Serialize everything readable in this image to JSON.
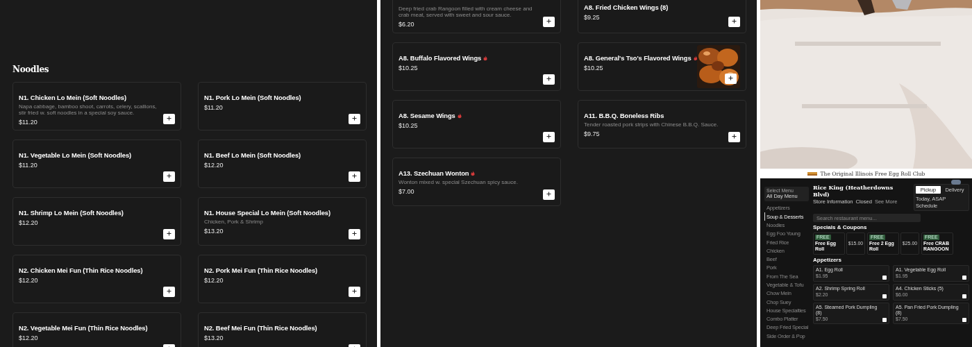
{
  "noodles_panel": {
    "heading": "Noodles",
    "items": [
      {
        "name": "N1. Chicken Lo Mein (Soft Noodles)",
        "description": "Napa cabbage, bamboo shoot, carrots, celery, scallions, stir fried w. soft noodles in a special soy sauce.",
        "price": "$11.20",
        "spicy": false,
        "has_photo": false
      },
      {
        "name": "N1. Pork Lo Mein (Soft Noodles)",
        "price": "$11.20",
        "spicy": false,
        "has_photo": false
      },
      {
        "name": "N1. Vegetable Lo Mein (Soft Noodles)",
        "price": "$11.20",
        "spicy": false,
        "has_photo": false
      },
      {
        "name": "N1. Beef Lo Mein (Soft Noodles)",
        "price": "$12.20",
        "spicy": false,
        "has_photo": false
      },
      {
        "name": "N1. Shrimp Lo Mein (Soft Noodles)",
        "price": "$12.20",
        "spicy": false,
        "has_photo": false
      },
      {
        "name": "N1. House Special Lo Mein (Soft Noodles)",
        "description": "Chicken, Pork & Shrimp",
        "price": "$13.20",
        "spicy": false,
        "has_photo": false
      },
      {
        "name": "N2. Chicken Mei Fun (Thin Rice Noodles)",
        "price": "$12.20",
        "spicy": false,
        "has_photo": false
      },
      {
        "name": "N2. Pork Mei Fun (Thin Rice Noodles)",
        "price": "$12.20",
        "spicy": false,
        "has_photo": false
      },
      {
        "name": "N2. Vegetable Mei Fun (Thin Rice Noodles)",
        "price": "$12.20",
        "spicy": false,
        "has_photo": false
      },
      {
        "name": "N2. Beef Mei Fun (Thin Rice Noodles)",
        "price": "$13.20",
        "spicy": false,
        "has_photo": false
      }
    ]
  },
  "appetizers_panel": {
    "items": [
      {
        "description": "Deep fried crab Rangoon filled with cream cheese and crab meat, served with sweet and sour sauce.",
        "price": "$6.20",
        "spicy": false,
        "has_photo": false
      },
      {
        "name": "A8. Fried Chicken Wings (8)",
        "price": "$9.25",
        "spicy": false,
        "has_photo": false
      },
      {
        "name": "A8. Buffalo Flavored Wings",
        "price": "$10.25",
        "spicy": true,
        "has_photo": false
      },
      {
        "name": "A8. General's Tso's Flavored Wings",
        "price": "$10.25",
        "spicy": true,
        "has_photo": true
      },
      {
        "name": "A8. Sesame Wings",
        "price": "$10.25",
        "spicy": true,
        "has_photo": false
      },
      {
        "name": "A11. B.B.Q. Boneless Ribs",
        "description": "Tender roasted pork strips with Chinese B.B.Q. Sauce.",
        "price": "$9.75",
        "spicy": false,
        "has_photo": false
      },
      {
        "name": "A13. Szechuan Wonton",
        "description": "Wonton mixed w. special Szechuan spicy sauce.",
        "price": "$7.00",
        "spicy": true,
        "has_photo": false
      }
    ]
  },
  "mini_site": {
    "banner": {
      "text": "The Original Illinois Free Egg Roll Club"
    },
    "menu_select": {
      "label": "Select Menu",
      "value": "All Day Menu"
    },
    "categories": [
      {
        "label": "Appetizers",
        "selected": false
      },
      {
        "label": "Soup & Desserts",
        "selected": true
      },
      {
        "label": "Noodles",
        "selected": false
      },
      {
        "label": "Egg Foo Young",
        "selected": false
      },
      {
        "label": "Fried Rice",
        "selected": false
      },
      {
        "label": "Chicken",
        "selected": false
      },
      {
        "label": "Beef",
        "selected": false
      },
      {
        "label": "Pork",
        "selected": false
      },
      {
        "label": "From The Sea",
        "selected": false
      },
      {
        "label": "Vegetable & Tofu",
        "selected": false
      },
      {
        "label": "Chow Mein",
        "selected": false
      },
      {
        "label": "Chop Suey",
        "selected": false
      },
      {
        "label": "House Specialties",
        "selected": false
      },
      {
        "label": "Combo Platter",
        "selected": false
      },
      {
        "label": "Deep Fried Special",
        "selected": false
      },
      {
        "label": "Side Order & Pop",
        "selected": false
      }
    ],
    "store_name": "Rice King (Heatherdowns Blvd)",
    "store_info": "Store Information",
    "store_status": "Closed",
    "see_more": "See More",
    "order_modes": [
      {
        "label": "Pickup",
        "selected": true
      },
      {
        "label": "Delivery",
        "selected": false
      }
    ],
    "time_label": "Today, ASAP",
    "schedule": "Schedule",
    "search": {
      "placeholder": "Search restaurant menu..."
    },
    "specials_heading": "Specials & Coupons",
    "coupons": [
      {
        "tag": "FREE",
        "title": "Free Egg Roll",
        "amount": "$15.00"
      },
      {
        "tag": "FREE",
        "title": "Free 2 Egg Roll",
        "amount": "$25.00"
      },
      {
        "tag": "FREE",
        "title": "Free CRAB RANGOON"
      }
    ],
    "section_heading": "Appetizers",
    "items": [
      {
        "name": "A1. Egg Roll",
        "price": "$1.95"
      },
      {
        "name": "A1. Vegetable Egg Roll",
        "price": "$1.95"
      },
      {
        "name": "A2. Shrimp Spring Roll",
        "price": "$2.20"
      },
      {
        "name": "A4. Chicken Sticks (5)",
        "price": "$6.00"
      },
      {
        "name": "A5. Steamed Pork Dumpling (8)",
        "price": "$7.50"
      },
      {
        "name": "A5. Pan Fried Pork Dumpling (8)",
        "price": "$7.50"
      }
    ]
  }
}
